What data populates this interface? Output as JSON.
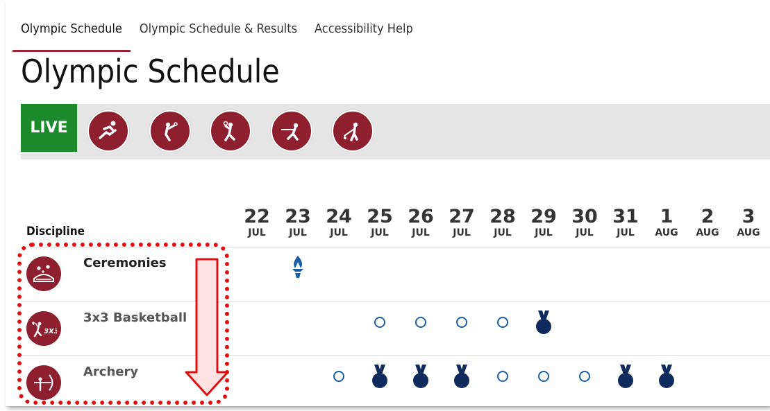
{
  "nav": {
    "items": [
      "Olympic Schedule",
      "Olympic Schedule & Results",
      "Accessibility Help"
    ]
  },
  "page_title": "Olympic Schedule",
  "live_label": "LIVE",
  "sport_buttons": [
    "running-icon",
    "badminton-icon",
    "handball-icon",
    "fencing-icon",
    "golf-icon"
  ],
  "table": {
    "discipline_header": "Discipline",
    "dates": [
      {
        "day": "22",
        "month": "JUL"
      },
      {
        "day": "23",
        "month": "JUL"
      },
      {
        "day": "24",
        "month": "JUL"
      },
      {
        "day": "25",
        "month": "JUL"
      },
      {
        "day": "26",
        "month": "JUL"
      },
      {
        "day": "27",
        "month": "JUL"
      },
      {
        "day": "28",
        "month": "JUL"
      },
      {
        "day": "29",
        "month": "JUL"
      },
      {
        "day": "30",
        "month": "JUL"
      },
      {
        "day": "31",
        "month": "JUL"
      },
      {
        "day": "1",
        "month": "AUG"
      },
      {
        "day": "2",
        "month": "AUG"
      },
      {
        "day": "3",
        "month": "AUG"
      }
    ],
    "rows": [
      {
        "name": "Ceremonies",
        "icon": "ceremonies-icon",
        "events": [
          "",
          "flame",
          "",
          "",
          "",
          "",
          "",
          "",
          "",
          "",
          "",
          "",
          ""
        ]
      },
      {
        "name": "3x3 Basketball",
        "icon": "basketball-3x3-icon",
        "events": [
          "",
          "",
          "",
          "circle",
          "circle",
          "circle",
          "circle",
          "medal",
          "",
          "",
          "",
          "",
          ""
        ]
      },
      {
        "name": "Archery",
        "icon": "archery-icon",
        "events": [
          "",
          "",
          "circle",
          "medal",
          "medal",
          "medal",
          "circle",
          "circle",
          "circle",
          "medal",
          "medal",
          "",
          ""
        ]
      }
    ]
  },
  "colors": {
    "brand": "#8d1f2e",
    "live": "#1a8a2a",
    "event": "#1b5fa8",
    "medal": "#0f2a5c",
    "annotation": "#e01010"
  }
}
